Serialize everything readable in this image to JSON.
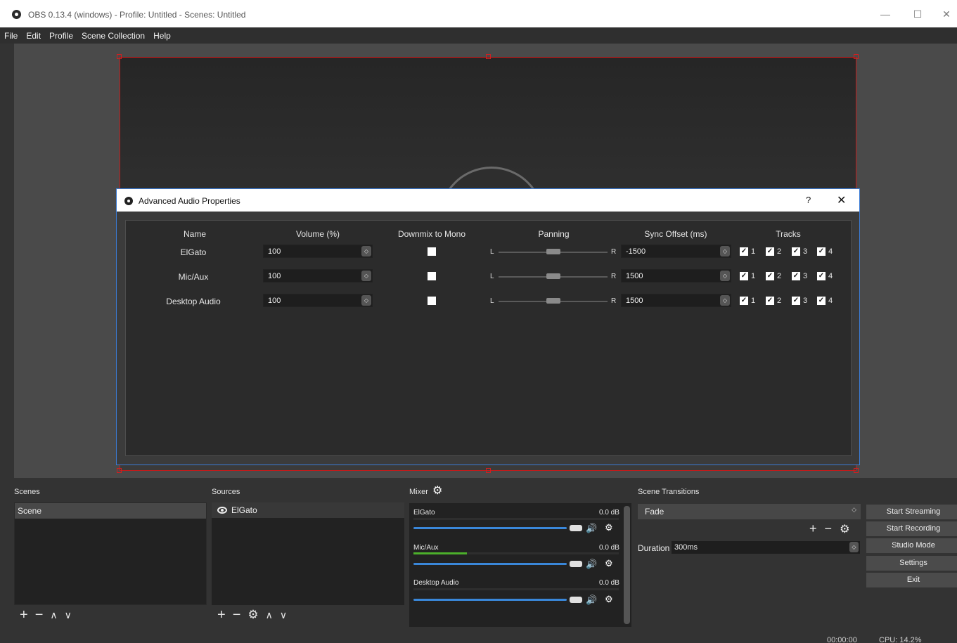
{
  "window": {
    "title": "OBS 0.13.4 (windows) - Profile: Untitled - Scenes: Untitled",
    "minimize": "—",
    "maximize": "☐",
    "close": "✕"
  },
  "menu": [
    "File",
    "Edit",
    "Profile",
    "Scene Collection",
    "Help"
  ],
  "dialog": {
    "title": "Advanced Audio Properties",
    "help": "?",
    "close": "✕",
    "columns": [
      "Name",
      "Volume (%)",
      "Downmix to Mono",
      "Panning",
      "Sync Offset (ms)",
      "Tracks"
    ],
    "pan_left": "L",
    "pan_right": "R",
    "rows": [
      {
        "name": "ElGato",
        "volume": "100",
        "offset": "-1500",
        "tracks": [
          "1",
          "2",
          "3",
          "4"
        ]
      },
      {
        "name": "Mic/Aux",
        "volume": "100",
        "offset": "1500",
        "tracks": [
          "1",
          "2",
          "3",
          "4"
        ]
      },
      {
        "name": "Desktop Audio",
        "volume": "100",
        "offset": "1500",
        "tracks": [
          "1",
          "2",
          "3",
          "4"
        ]
      }
    ]
  },
  "scenes": {
    "title": "Scenes",
    "items": [
      "Scene"
    ]
  },
  "sources": {
    "title": "Sources",
    "items": [
      "ElGato"
    ]
  },
  "mixer": {
    "title": "Mixer",
    "channels": [
      {
        "name": "ElGato",
        "db": "0.0 dB"
      },
      {
        "name": "Mic/Aux",
        "db": "0.0 dB"
      },
      {
        "name": "Desktop Audio",
        "db": "0.0 dB"
      }
    ]
  },
  "transitions": {
    "title": "Scene Transitions",
    "selected": "Fade",
    "duration_label": "Duration",
    "duration_value": "300ms"
  },
  "controls": {
    "start_streaming": "Start Streaming",
    "start_recording": "Start Recording",
    "studio_mode": "Studio Mode",
    "settings": "Settings",
    "exit": "Exit"
  },
  "status": {
    "time": "00:00:00",
    "cpu": "CPU: 14.2%"
  },
  "colors": {
    "accent_blue": "#3a87d9",
    "selection_red": "#c51a1a",
    "meter_green": "#4caf2b"
  }
}
